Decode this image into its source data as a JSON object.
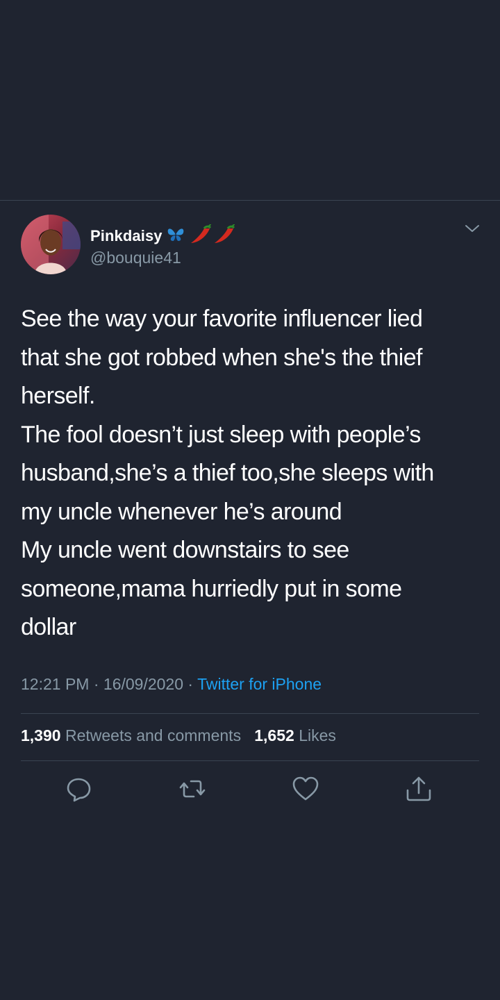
{
  "user": {
    "display_name": "Pinkdaisy",
    "name_emojis": [
      "butterfly-icon",
      "chili-pepper-icon",
      "chili-pepper-icon"
    ],
    "handle": "@bouquie41"
  },
  "tweet": {
    "lines": [
      "See the way your favorite influencer  lied",
      "that she got robbed when she's the thief",
      "herself.",
      "The fool doesn’t just sleep with people’s",
      "husband,she’s a thief too,she sleeps with",
      "my uncle whenever he’s around",
      "My uncle went downstairs to see",
      "someone,mama hurriedly put in some",
      "dollar"
    ],
    "time": "12:21 PM",
    "date": "16/09/2020",
    "source": "Twitter for iPhone",
    "separator": "·"
  },
  "stats": {
    "retweets_count": "1,390",
    "retweets_label": "Retweets and comments",
    "likes_count": "1,652",
    "likes_label": "Likes"
  },
  "icons": {
    "menu": "chevron-down-icon",
    "actions": [
      "reply-icon",
      "retweet-icon",
      "like-icon",
      "share-icon"
    ]
  },
  "colors": {
    "background": "#1f2430",
    "text": "#ffffff",
    "secondary": "#8899a6",
    "accent": "#1da1f2",
    "divider": "#3a4452"
  }
}
